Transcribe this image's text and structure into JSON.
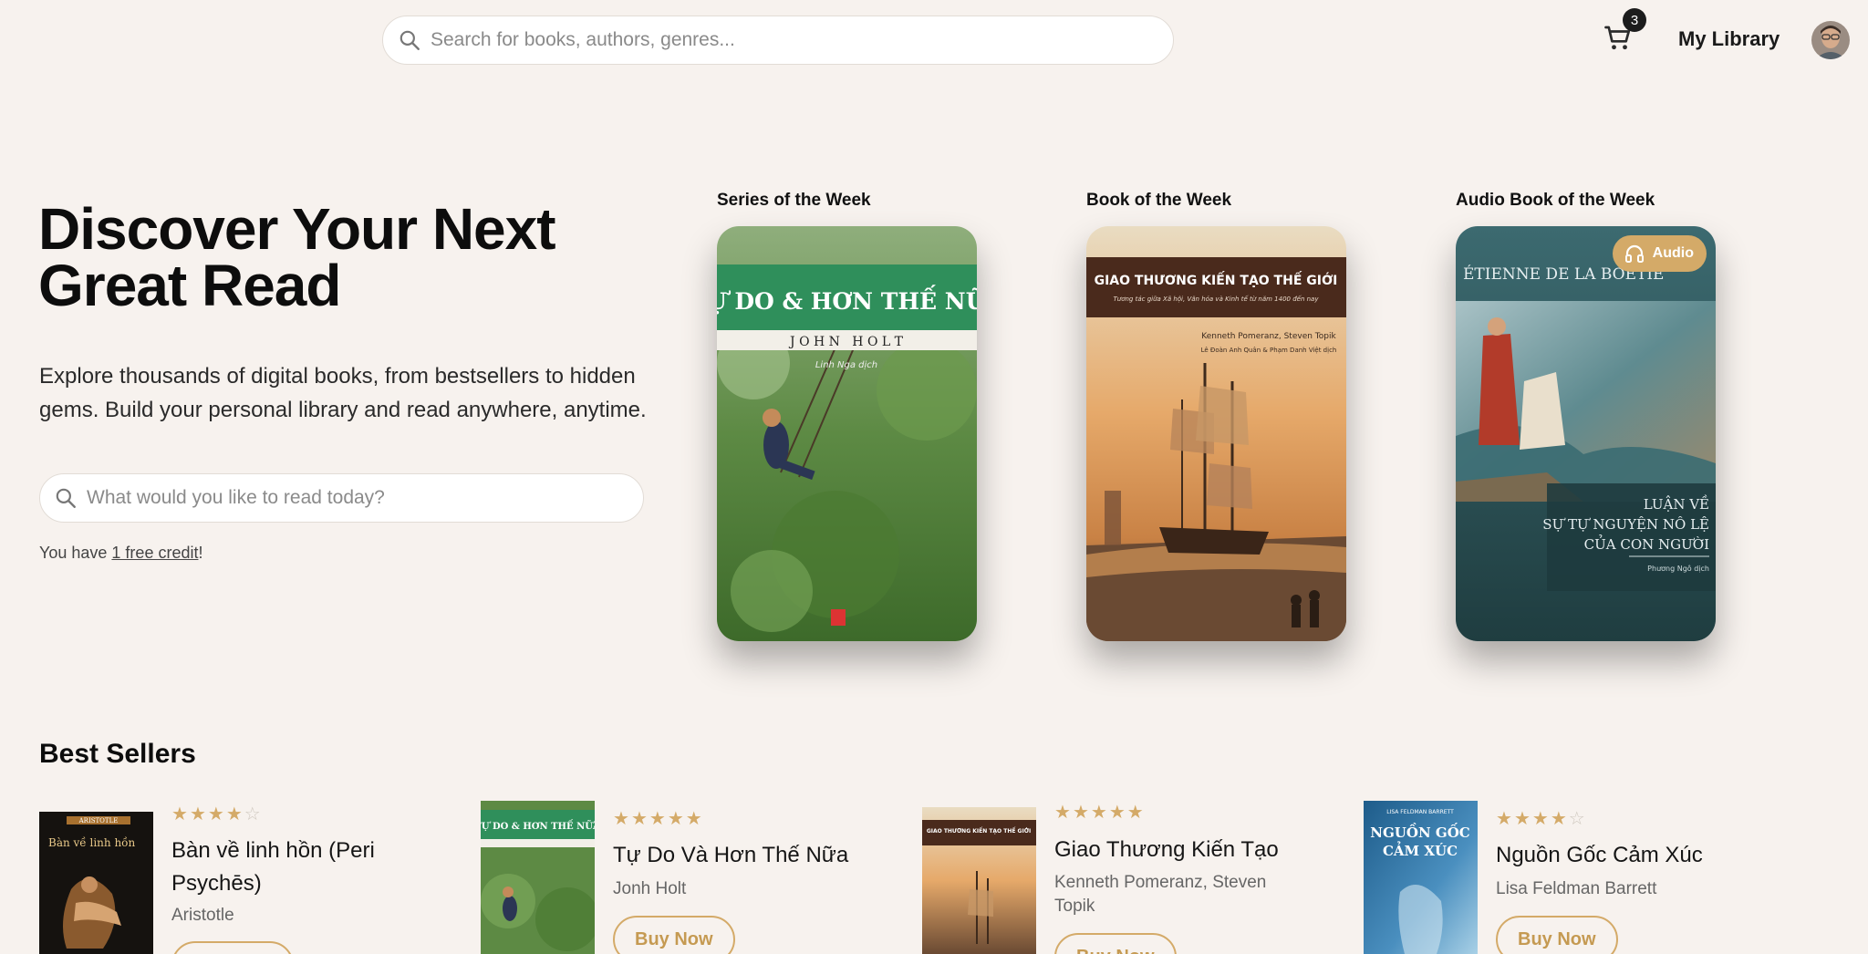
{
  "header": {
    "search_placeholder": "Search for books, authors, genres...",
    "cart_count": "3",
    "my_library": "My Library"
  },
  "hero": {
    "title": "Discover Your Next Great Read",
    "subtitle": "Explore thousands of digital books, from bestsellers to hidden gems. Build your personal library and read anywhere, anytime.",
    "search_placeholder": "What would you like to read today?",
    "credit_prefix": "You have ",
    "credit_link": "1 free credit",
    "credit_suffix": "!"
  },
  "features": [
    {
      "label": "Series of the Week",
      "cover_title": "TỰ DO & HƠN THẾ NỮA",
      "cover_author": "J O H N   H O L T",
      "cover_translator": "Linh Nga dịch"
    },
    {
      "label": "Book of the Week",
      "cover_title": "GIAO THƯƠNG KIẾN TẠO THẾ GIỚI",
      "cover_subtitle": "Tương tác giữa Xã hội, Văn hóa và Kinh tế từ năm 1400 đến nay",
      "cover_authors": "Kenneth Pomeranz, Steven Topik",
      "cover_translators": "Lê Đoàn Anh Quân & Phạm Danh Việt dịch"
    },
    {
      "label": "Audio Book of the Week",
      "badge": "Audio",
      "cover_author": "ÉTIENNE DE LA BOÉTIE",
      "cover_title_1": "LUẬN VỀ",
      "cover_title_2": "SỰ TỰ NGUYỆN NÔ LỆ",
      "cover_title_3": "CỦA CON NGƯỜI",
      "cover_translator": "Phương Ngô dịch"
    }
  ],
  "best_sellers": {
    "title": "Best Sellers",
    "buy_label": "Buy Now",
    "items": [
      {
        "name": "Bàn về linh hồn (Peri Psychēs)",
        "author": "Aristotle",
        "rating": 4,
        "cover_title": "Bàn về linh hồn",
        "cover_author": "ARISTOTLE"
      },
      {
        "name": "Tự Do Và Hơn Thế Nữa",
        "author": "Jonh Holt",
        "rating": 5,
        "cover_title": "TỰ DO & HƠN THẾ NỮA"
      },
      {
        "name": "Giao Thương Kiến Tạo",
        "author": "Kenneth Pomeranz, Steven Topik",
        "rating": 5,
        "cover_title": "GIAO THƯƠNG KIẾN TẠO THẾ GIỚI"
      },
      {
        "name": "Nguồn Gốc Cảm Xúc",
        "author": "Lisa Feldman Barrett",
        "rating": 4,
        "cover_author": "LISA FELDMAN BARRETT",
        "cover_title_1": "NGUỒN GỐC",
        "cover_title_2": "CẢM XÚC"
      }
    ]
  },
  "colors": {
    "background": "#f7f2ee",
    "accent": "#d4aa68"
  }
}
